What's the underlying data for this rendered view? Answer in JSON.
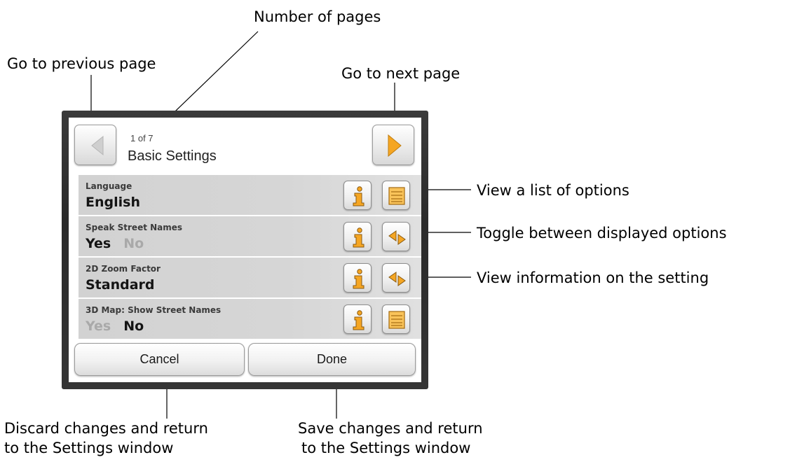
{
  "annotations": {
    "number_of_pages": "Number of pages",
    "previous_page": "Go to previous page",
    "next_page": "Go to next page",
    "view_list": "View a list of options",
    "toggle_options": "Toggle between displayed options",
    "view_info": "View information on the setting",
    "discard_line1": "Discard changes and return",
    "discard_line2": "to the Settings window",
    "save_line1": "Save changes and return",
    "save_line2": "to the Settings window"
  },
  "screen": {
    "page_count": "1 of 7",
    "title": "Basic Settings",
    "prev_icon": "left-arrow-icon",
    "next_icon": "right-arrow-icon",
    "settings": [
      {
        "label": "Language",
        "value": "English",
        "action": "list-icon"
      },
      {
        "label": "Speak Street Names",
        "options": [
          "Yes",
          "No"
        ],
        "selected": "Yes",
        "action": "toggle-icon"
      },
      {
        "label": "2D Zoom Factor",
        "value": "Standard",
        "action": "toggle-icon"
      },
      {
        "label": "3D Map: Show Street Names",
        "options": [
          "Yes",
          "No"
        ],
        "selected": "No",
        "action": "list-icon"
      }
    ],
    "info_icon": "info-icon",
    "cancel_label": "Cancel",
    "done_label": "Done"
  },
  "colors": {
    "accent_orange": "#f5a623",
    "row_bg": "#d4d4d4",
    "frame": "#2e2e2e"
  }
}
